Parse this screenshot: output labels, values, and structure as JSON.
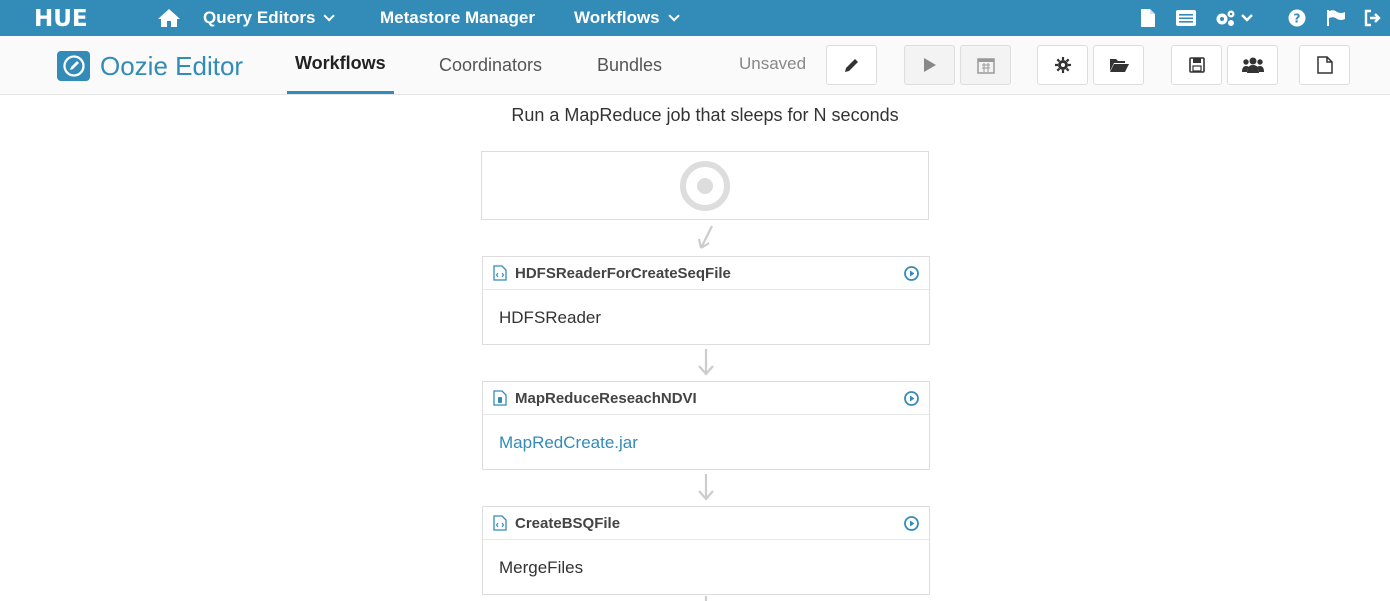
{
  "topbar": {
    "logo": "HUE",
    "nav": [
      {
        "label": "Query Editors",
        "dropdown": true
      },
      {
        "label": "Metastore Manager",
        "dropdown": false
      },
      {
        "label": "Workflows",
        "dropdown": true
      }
    ],
    "right_icons": [
      "file-icon",
      "list-icon",
      "cogs-icon",
      "help-icon",
      "flag-icon",
      "logout-icon"
    ]
  },
  "editor": {
    "title": "Oozie Editor",
    "tabs": [
      "Workflows",
      "Coordinators",
      "Bundles"
    ],
    "active_tab": "Workflows",
    "status": "Unsaved",
    "toolbar": [
      "edit-icon",
      "play-icon",
      "calendar-icon",
      "gear-icon",
      "folder-open-icon",
      "save-icon",
      "users-icon",
      "new-file-icon"
    ]
  },
  "workflow": {
    "name": "Run a MapReduce job that sleeps for N seconds",
    "nodes": [
      {
        "title": "HDFSReaderForCreateSeqFile",
        "body": "HDFSReader",
        "icon": "code-file-icon",
        "link": false
      },
      {
        "title": "MapReduceReseachNDVI",
        "body": "MapRedCreate.jar",
        "icon": "jar-file-icon",
        "link": true
      },
      {
        "title": "CreateBSQFile",
        "body": "MergeFiles",
        "icon": "code-file-icon",
        "link": false
      }
    ]
  },
  "colors": {
    "brand": "#338bb8",
    "node_border": "#dddddd",
    "text": "#333333"
  }
}
